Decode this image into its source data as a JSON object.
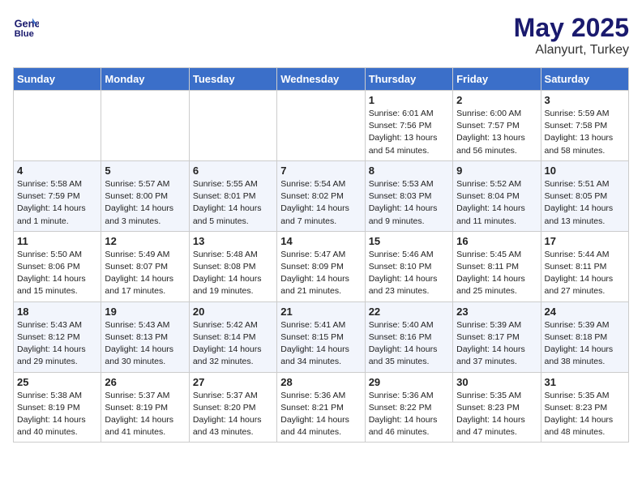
{
  "header": {
    "logo_line1": "General",
    "logo_line2": "Blue",
    "month": "May 2025",
    "location": "Alanyurt, Turkey"
  },
  "days_of_week": [
    "Sunday",
    "Monday",
    "Tuesday",
    "Wednesday",
    "Thursday",
    "Friday",
    "Saturday"
  ],
  "weeks": [
    [
      {
        "day": "",
        "info": ""
      },
      {
        "day": "",
        "info": ""
      },
      {
        "day": "",
        "info": ""
      },
      {
        "day": "",
        "info": ""
      },
      {
        "day": "1",
        "info": "Sunrise: 6:01 AM\nSunset: 7:56 PM\nDaylight: 13 hours\nand 54 minutes."
      },
      {
        "day": "2",
        "info": "Sunrise: 6:00 AM\nSunset: 7:57 PM\nDaylight: 13 hours\nand 56 minutes."
      },
      {
        "day": "3",
        "info": "Sunrise: 5:59 AM\nSunset: 7:58 PM\nDaylight: 13 hours\nand 58 minutes."
      }
    ],
    [
      {
        "day": "4",
        "info": "Sunrise: 5:58 AM\nSunset: 7:59 PM\nDaylight: 14 hours\nand 1 minute."
      },
      {
        "day": "5",
        "info": "Sunrise: 5:57 AM\nSunset: 8:00 PM\nDaylight: 14 hours\nand 3 minutes."
      },
      {
        "day": "6",
        "info": "Sunrise: 5:55 AM\nSunset: 8:01 PM\nDaylight: 14 hours\nand 5 minutes."
      },
      {
        "day": "7",
        "info": "Sunrise: 5:54 AM\nSunset: 8:02 PM\nDaylight: 14 hours\nand 7 minutes."
      },
      {
        "day": "8",
        "info": "Sunrise: 5:53 AM\nSunset: 8:03 PM\nDaylight: 14 hours\nand 9 minutes."
      },
      {
        "day": "9",
        "info": "Sunrise: 5:52 AM\nSunset: 8:04 PM\nDaylight: 14 hours\nand 11 minutes."
      },
      {
        "day": "10",
        "info": "Sunrise: 5:51 AM\nSunset: 8:05 PM\nDaylight: 14 hours\nand 13 minutes."
      }
    ],
    [
      {
        "day": "11",
        "info": "Sunrise: 5:50 AM\nSunset: 8:06 PM\nDaylight: 14 hours\nand 15 minutes."
      },
      {
        "day": "12",
        "info": "Sunrise: 5:49 AM\nSunset: 8:07 PM\nDaylight: 14 hours\nand 17 minutes."
      },
      {
        "day": "13",
        "info": "Sunrise: 5:48 AM\nSunset: 8:08 PM\nDaylight: 14 hours\nand 19 minutes."
      },
      {
        "day": "14",
        "info": "Sunrise: 5:47 AM\nSunset: 8:09 PM\nDaylight: 14 hours\nand 21 minutes."
      },
      {
        "day": "15",
        "info": "Sunrise: 5:46 AM\nSunset: 8:10 PM\nDaylight: 14 hours\nand 23 minutes."
      },
      {
        "day": "16",
        "info": "Sunrise: 5:45 AM\nSunset: 8:11 PM\nDaylight: 14 hours\nand 25 minutes."
      },
      {
        "day": "17",
        "info": "Sunrise: 5:44 AM\nSunset: 8:11 PM\nDaylight: 14 hours\nand 27 minutes."
      }
    ],
    [
      {
        "day": "18",
        "info": "Sunrise: 5:43 AM\nSunset: 8:12 PM\nDaylight: 14 hours\nand 29 minutes."
      },
      {
        "day": "19",
        "info": "Sunrise: 5:43 AM\nSunset: 8:13 PM\nDaylight: 14 hours\nand 30 minutes."
      },
      {
        "day": "20",
        "info": "Sunrise: 5:42 AM\nSunset: 8:14 PM\nDaylight: 14 hours\nand 32 minutes."
      },
      {
        "day": "21",
        "info": "Sunrise: 5:41 AM\nSunset: 8:15 PM\nDaylight: 14 hours\nand 34 minutes."
      },
      {
        "day": "22",
        "info": "Sunrise: 5:40 AM\nSunset: 8:16 PM\nDaylight: 14 hours\nand 35 minutes."
      },
      {
        "day": "23",
        "info": "Sunrise: 5:39 AM\nSunset: 8:17 PM\nDaylight: 14 hours\nand 37 minutes."
      },
      {
        "day": "24",
        "info": "Sunrise: 5:39 AM\nSunset: 8:18 PM\nDaylight: 14 hours\nand 38 minutes."
      }
    ],
    [
      {
        "day": "25",
        "info": "Sunrise: 5:38 AM\nSunset: 8:19 PM\nDaylight: 14 hours\nand 40 minutes."
      },
      {
        "day": "26",
        "info": "Sunrise: 5:37 AM\nSunset: 8:19 PM\nDaylight: 14 hours\nand 41 minutes."
      },
      {
        "day": "27",
        "info": "Sunrise: 5:37 AM\nSunset: 8:20 PM\nDaylight: 14 hours\nand 43 minutes."
      },
      {
        "day": "28",
        "info": "Sunrise: 5:36 AM\nSunset: 8:21 PM\nDaylight: 14 hours\nand 44 minutes."
      },
      {
        "day": "29",
        "info": "Sunrise: 5:36 AM\nSunset: 8:22 PM\nDaylight: 14 hours\nand 46 minutes."
      },
      {
        "day": "30",
        "info": "Sunrise: 5:35 AM\nSunset: 8:23 PM\nDaylight: 14 hours\nand 47 minutes."
      },
      {
        "day": "31",
        "info": "Sunrise: 5:35 AM\nSunset: 8:23 PM\nDaylight: 14 hours\nand 48 minutes."
      }
    ]
  ]
}
